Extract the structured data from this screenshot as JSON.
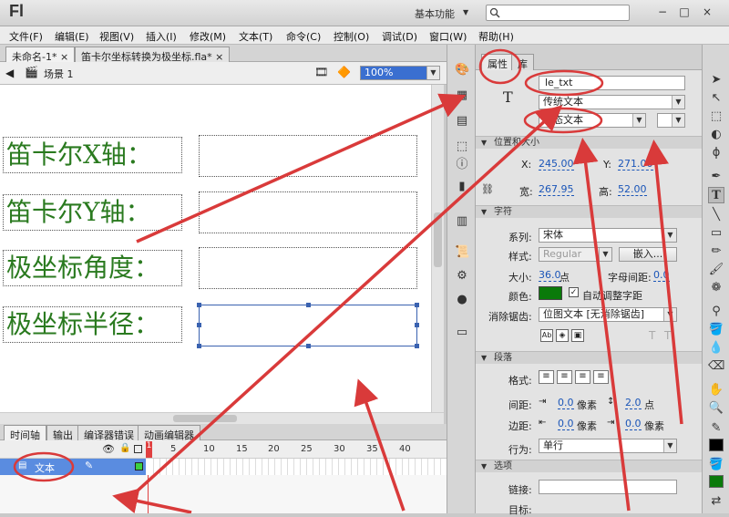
{
  "app": {
    "logo": "Fl",
    "workspace": "基本功能",
    "window_controls": [
      "−",
      "□",
      "×"
    ]
  },
  "menu": [
    "文件(F)",
    "编辑(E)",
    "视图(V)",
    "插入(I)",
    "修改(M)",
    "文本(T)",
    "命令(C)",
    "控制(O)",
    "调试(D)",
    "窗口(W)",
    "帮助(H)"
  ],
  "doc_tabs": [
    {
      "label": "未命名-1*",
      "close": "×"
    },
    {
      "label": "笛卡尔坐标转换为极坐标.fla*",
      "close": "×"
    }
  ],
  "scene": {
    "label": "场景 1",
    "zoom": "100%"
  },
  "stage": {
    "labels": [
      "笛卡尔X轴：",
      "笛卡尔Y轴：",
      "极坐标角度：",
      "极坐标半径："
    ]
  },
  "timeline": {
    "tabs": [
      "时间轴",
      "输出",
      "编译器错误",
      "动画编辑器"
    ],
    "frame_numbers": [
      "5",
      "10",
      "15",
      "20",
      "25",
      "30",
      "35",
      "40"
    ],
    "current_frame": "1",
    "layer_name": "文本"
  },
  "properties": {
    "tabs": [
      "属性",
      "库"
    ],
    "instance_name": "le_txt",
    "text_engine": "传统文本",
    "text_type": "动态文本",
    "sections": {
      "position": "位置和大小",
      "character": "字符",
      "paragraph": "段落",
      "options": "选项"
    },
    "x_label": "X:",
    "x": "245.00",
    "y_label": "Y:",
    "y": "271.00",
    "w_label": "宽:",
    "w": "267.95",
    "h_label": "高:",
    "h": "52.00",
    "family_label": "系列:",
    "family": "宋体",
    "style_label": "样式:",
    "style": "Regular",
    "embed": "嵌入...",
    "size_label": "大小:",
    "size": "36.0",
    "size_unit": "点",
    "spacing_label": "字母间距:",
    "spacing": "0.0",
    "color_label": "颜色:",
    "color": "#0a7a0a",
    "autokern": "自动调整字距",
    "aa_label": "消除锯齿:",
    "aa": "位图文本 [无消除锯齿]",
    "format_label": "格式:",
    "indent_label": "间距:",
    "indent": "0.0",
    "indent_unit": "像素",
    "linespace": "2.0",
    "linespace_unit": "点",
    "margin_label": "边距:",
    "margin_l": "0.0",
    "margin_l_unit": "像素",
    "margin_r": "0.0",
    "margin_r_unit": "像素",
    "behavior_label": "行为:",
    "behavior": "单行",
    "link_label": "链接:",
    "target_label": "目标:"
  },
  "colors": {
    "accent_annotation": "#d93a3a",
    "stage_text": "#2a7a1f",
    "selection": "#3a62b0"
  }
}
